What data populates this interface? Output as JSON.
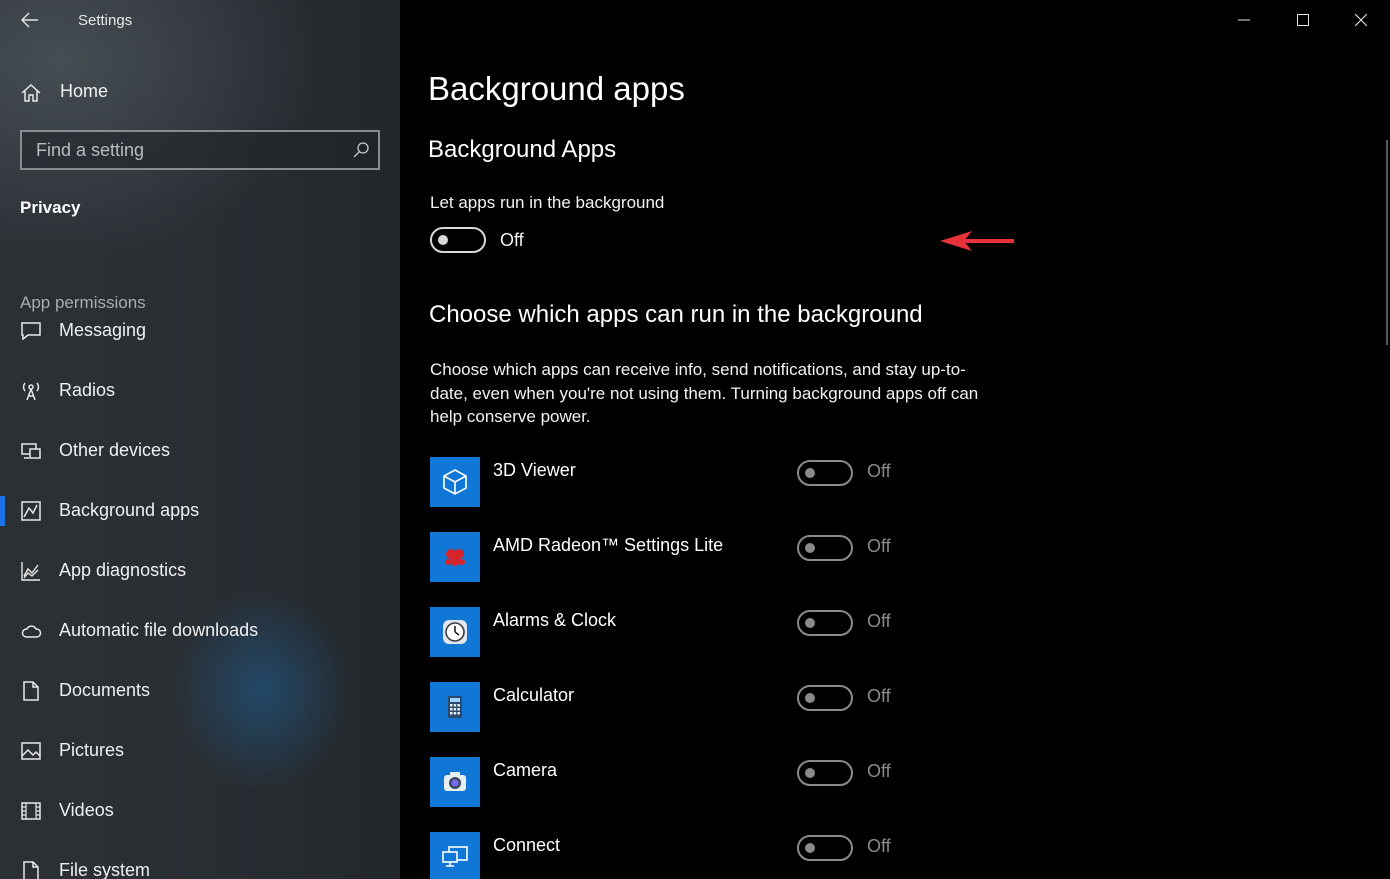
{
  "window": {
    "title": "Settings",
    "controls": [
      "minimize",
      "maximize",
      "close"
    ]
  },
  "sidebar": {
    "home_label": "Home",
    "search_placeholder": "Find a setting",
    "section_title": "Privacy",
    "group_label": "App permissions",
    "items": [
      {
        "label": "Messaging",
        "icon": "messaging-icon"
      },
      {
        "label": "Radios",
        "icon": "radio-tower-icon"
      },
      {
        "label": "Other devices",
        "icon": "devices-icon"
      },
      {
        "label": "Background apps",
        "icon": "background-apps-icon",
        "selected": true
      },
      {
        "label": "App diagnostics",
        "icon": "diagnostics-chart-icon"
      },
      {
        "label": "Automatic file downloads",
        "icon": "cloud-icon"
      },
      {
        "label": "Documents",
        "icon": "document-icon"
      },
      {
        "label": "Pictures",
        "icon": "picture-icon"
      },
      {
        "label": "Videos",
        "icon": "film-icon"
      },
      {
        "label": "File system",
        "icon": "file-icon"
      }
    ]
  },
  "main": {
    "page_title": "Background apps",
    "sub_title": "Background Apps",
    "master_toggle": {
      "caption": "Let apps run in the background",
      "state": "Off"
    },
    "choose_title": "Choose which apps can run in the background",
    "description": "Choose which apps can receive info, send notifications, and stay up-to-date, even when you're not using them. Turning background apps off can help conserve power.",
    "apps": [
      {
        "name": "3D Viewer",
        "state": "Off",
        "icon": "3d-cube-icon"
      },
      {
        "name": "AMD Radeon™ Settings Lite",
        "state": "Off",
        "icon": "amd-radeon-icon"
      },
      {
        "name": "Alarms & Clock",
        "state": "Off",
        "icon": "clock-icon"
      },
      {
        "name": "Calculator",
        "state": "Off",
        "icon": "calculator-icon"
      },
      {
        "name": "Camera",
        "state": "Off",
        "icon": "camera-icon"
      },
      {
        "name": "Connect",
        "state": "Off",
        "icon": "connect-screen-icon"
      }
    ]
  },
  "colors": {
    "accent": "#1a73e8",
    "app_tile": "#1077d6",
    "annotation_arrow": "#e8323a"
  }
}
